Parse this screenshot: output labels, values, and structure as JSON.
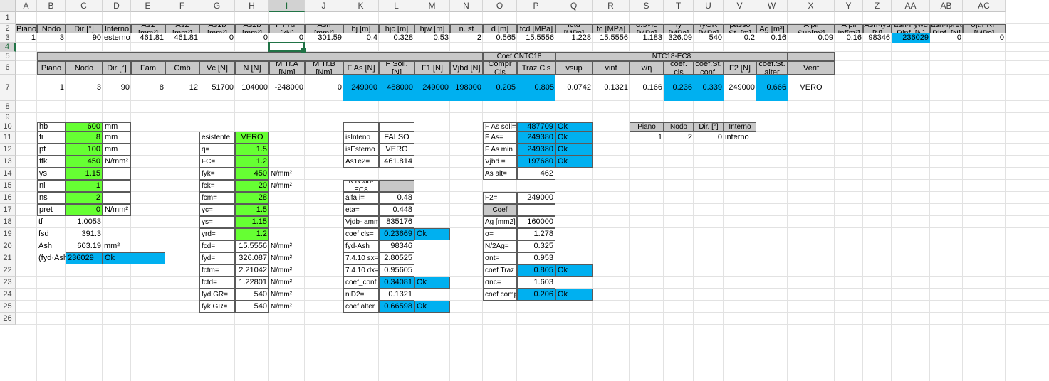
{
  "sheet": {
    "columns": [
      "A",
      "B",
      "C",
      "D",
      "E",
      "F",
      "G",
      "H",
      "I",
      "J",
      "K",
      "L",
      "M",
      "N",
      "O",
      "P",
      "Q",
      "R",
      "S",
      "T",
      "U",
      "V",
      "W",
      "X",
      "Y",
      "Z",
      "AA",
      "AB",
      "AC"
    ],
    "rows": [
      "1",
      "2",
      "3",
      "4",
      "5",
      "6",
      "7",
      "8",
      "9",
      "10",
      "11",
      "12",
      "13",
      "14",
      "15",
      "16",
      "17",
      "18",
      "19",
      "20",
      "21",
      "22",
      "23",
      "24",
      "25",
      "26"
    ],
    "selected_column": "I",
    "selected_row": "4"
  },
  "colors": {
    "header_gray": "#c8c8c8",
    "highlight_blue": "#00b0f0",
    "input_green": "#66ff33",
    "selection_green": "#217346"
  },
  "top_table": {
    "headers": [
      "Piano",
      "Nodo",
      "Dir [°]",
      "Interno",
      "As1 [mm²]",
      "As2 [mm²]",
      "As1b [mm²]",
      "As2b [mm²]",
      "F FRP [kN]",
      "Ash [mm²]",
      "bj [m]",
      "hjc [m]",
      "hjw [m]",
      "n. st",
      "d [m]",
      "fcd [MPa]",
      "fctd [MPa]",
      "fc [MPa]",
      "0.3√fc [MPa]",
      "fy [MPa]",
      "fyGR [MPa]",
      "passo St. [m]",
      "Ag [m²]",
      "A pil Sup[m²]",
      "A pil Inf[m²]",
      "Ash·fyd [N]",
      "ash·Fywd Rinf. [N]",
      "ash·fpret Rinf. [N]",
      "σjt,FRP [MPa]"
    ],
    "values": [
      "1",
      "3",
      "90",
      "esterno",
      "461.81",
      "461.81",
      "0",
      "0",
      "0",
      "301.59",
      "0.4",
      "0.328",
      "0.53",
      "2",
      "0.565",
      "15.5556",
      "1.228",
      "15.5556",
      "1.183",
      "326.09",
      "540",
      "0.2",
      "0.16",
      "0.09",
      "0.16",
      "98346",
      "236029",
      "0",
      "0"
    ]
  },
  "check_table": {
    "group_labels": [
      "Coef CNTC18",
      "NTC18-EC8"
    ],
    "headers": [
      "Piano",
      "Nodo",
      "Dir [°]",
      "Fam",
      "Cmb",
      "Vc [N]",
      "N [N]",
      "M Tr.A [Nm]",
      "M Tr.B [Nm]",
      "F As [N]",
      "F Soll. [N]",
      "F1 [N]",
      "Vjbd [N]",
      "Compr Cls",
      "Traz Cls",
      "vsup",
      "vinf",
      "v/η",
      "coef. cls",
      "coef.St. conf.",
      "F2 [N]",
      "coef.St. alter",
      "Verif"
    ],
    "values": [
      "1",
      "3",
      "90",
      "8",
      "12",
      "51700",
      "104000",
      "-248000",
      "0",
      "249000",
      "488000",
      "249000",
      "198000",
      "0.205",
      "0.805",
      "0.0742",
      "0.1321",
      "0.166",
      "0.236",
      "0.339",
      "249000",
      "0.666",
      "VERO"
    ]
  },
  "geom_block": {
    "rows": [
      {
        "label": "hb",
        "value": "600",
        "unit": "mm"
      },
      {
        "label": "fi",
        "value": "8",
        "unit": "mm"
      },
      {
        "label": "pf",
        "value": "100",
        "unit": "mm"
      },
      {
        "label": "ffk",
        "value": "450",
        "unit": "N/mm²"
      },
      {
        "label": "γs",
        "value": "1.15",
        "unit": ""
      },
      {
        "label": "nl",
        "value": "1",
        "unit": ""
      },
      {
        "label": "ns",
        "value": "2",
        "unit": ""
      },
      {
        "label": "pret",
        "value": "0",
        "unit": "N/mm²"
      },
      {
        "label": "tf",
        "value": "1.0053",
        "unit": ""
      },
      {
        "label": "fsd",
        "value": "391.3",
        "unit": ""
      },
      {
        "label": "Ash",
        "value": "603.19",
        "unit": "mm²"
      },
      {
        "label": "(fyd·Ash)",
        "value": "236029",
        "unit": "",
        "status": "Ok"
      }
    ]
  },
  "material_block": {
    "rows": [
      {
        "label": "esistente",
        "value": "VERO",
        "unit": ""
      },
      {
        "label": "q=",
        "value": "1.5",
        "unit": ""
      },
      {
        "label": "FC=",
        "value": "1.2",
        "unit": ""
      },
      {
        "label": "fyk=",
        "value": "450",
        "unit": "N/mm²"
      },
      {
        "label": "fck=",
        "value": "20",
        "unit": "N/mm²"
      },
      {
        "label": "fcm=",
        "value": "28",
        "unit": ""
      },
      {
        "label": "γc=",
        "value": "1.5",
        "unit": ""
      },
      {
        "label": "γs=",
        "value": "1.15",
        "unit": ""
      },
      {
        "label": "γrd=",
        "value": "1.2",
        "unit": ""
      },
      {
        "label": "fcd=",
        "value": "15.5556",
        "unit": "N/mm²"
      },
      {
        "label": "fyd=",
        "value": "326.087",
        "unit": "N/mm²"
      },
      {
        "label": "fctm=",
        "value": "2.21042",
        "unit": "N/mm²"
      },
      {
        "label": "fctd=",
        "value": "1.22801",
        "unit": "N/mm²"
      },
      {
        "label": "fyd GR=",
        "value": "540",
        "unit": "N/mm²"
      },
      {
        "label": "fyk GR=",
        "value": "540",
        "unit": "N/mm²"
      }
    ]
  },
  "flags_block": {
    "rows": [
      {
        "label": "isInteno",
        "value": "FALSO"
      },
      {
        "label": "isEsterno",
        "value": "VERO"
      },
      {
        "label": "As1e2=",
        "value": "461.814"
      }
    ],
    "ntc_header": "NTC08-EC8",
    "ntc_rows": [
      {
        "label": "alfa i=",
        "value": "0.48",
        "status": ""
      },
      {
        "label": "eta=",
        "value": "0.448",
        "status": ""
      },
      {
        "label": "Vjdb- amm",
        "value": "835176",
        "status": ""
      },
      {
        "label": "coef cls=",
        "value": "0.23669",
        "status": "Ok"
      },
      {
        "label": "fyd·Ash",
        "value": "98346",
        "status": ""
      },
      {
        "label": "7.4.10 sx=",
        "value": "2.80525",
        "status": ""
      },
      {
        "label": "7.4.10 dx=",
        "value": "0.95605",
        "status": ""
      },
      {
        "label": "coef_conf",
        "value": "0.34081",
        "status": "Ok"
      },
      {
        "label": "niD2=",
        "value": "0.1321",
        "status": ""
      },
      {
        "label": "coef alter",
        "value": "0.66598",
        "status": "Ok"
      }
    ]
  },
  "forces_block": {
    "rows": [
      {
        "label": "F As soll=",
        "value": "487709",
        "status": "Ok"
      },
      {
        "label": "F As=",
        "value": "249380",
        "status": "Ok"
      },
      {
        "label": "F As min",
        "value": "249380",
        "status": "Ok"
      },
      {
        "label": "Vjbd =",
        "value": "197680",
        "status": "Ok"
      },
      {
        "label": "As alt=",
        "value": "462",
        "status": ""
      },
      {
        "label": "F2=",
        "value": "249000",
        "status": ""
      }
    ],
    "coef_header": "Coef",
    "coef_rows": [
      {
        "label": "Ag [mm2]",
        "value": "160000",
        "status": ""
      },
      {
        "label": "σ=",
        "value": "1.278",
        "status": ""
      },
      {
        "label": "N/2Ag=",
        "value": "0.325",
        "status": ""
      },
      {
        "label": "σnt=",
        "value": "0.953",
        "status": ""
      },
      {
        "label": "coef Traz",
        "value": "0.805",
        "status": "Ok"
      },
      {
        "label": "σnc=",
        "value": "1.603",
        "status": ""
      },
      {
        "label": "coef comp",
        "value": "0.206",
        "status": "Ok"
      }
    ]
  },
  "node_table": {
    "headers": [
      "Piano",
      "Nodo",
      "Dir. [°]",
      "Interno"
    ],
    "values": [
      "1",
      "2",
      "0",
      "interno"
    ]
  }
}
